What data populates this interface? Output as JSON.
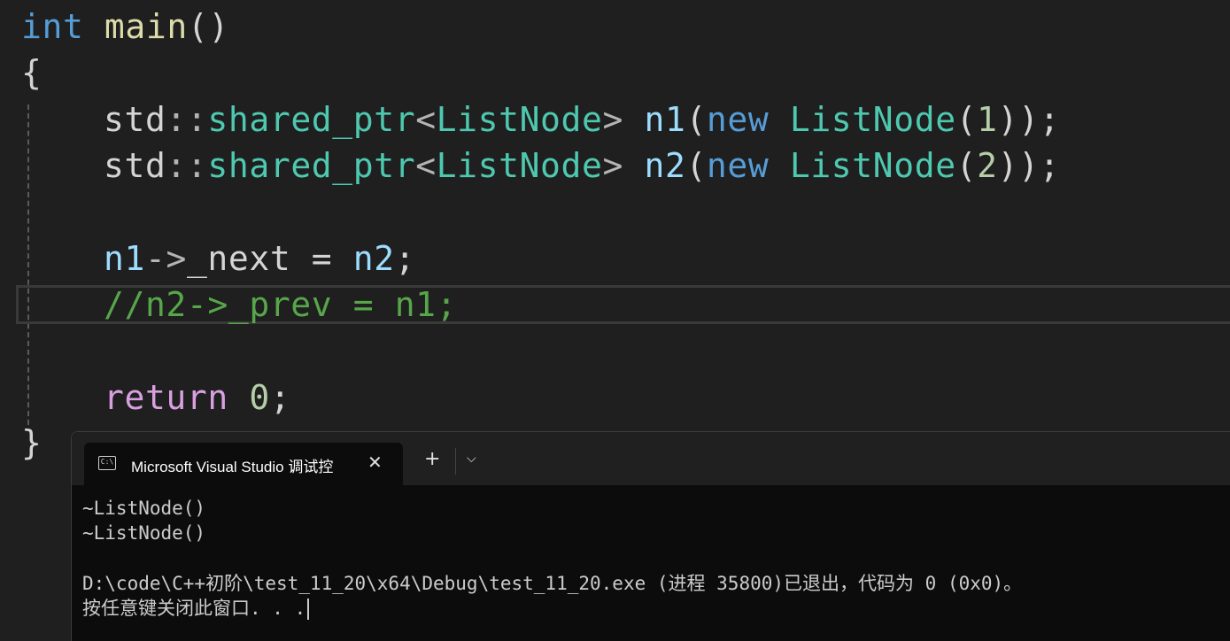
{
  "code": {
    "l1": {
      "kw": "int",
      "fn": "main",
      "rest": "()"
    },
    "l2": "{",
    "l3": {
      "ns": "std",
      "sep": "::",
      "ty": "shared_ptr",
      "lt": "<",
      "ty2": "ListNode",
      "gt": ">",
      "var": "n1",
      "p1": "(",
      "kw": "new",
      "ty3": "ListNode",
      "p2": "(",
      "num": "1",
      "p3": "));"
    },
    "l4": {
      "ns": "std",
      "sep": "::",
      "ty": "shared_ptr",
      "lt": "<",
      "ty2": "ListNode",
      "gt": ">",
      "var": "n2",
      "p1": "(",
      "kw": "new",
      "ty3": "ListNode",
      "p2": "(",
      "num": "2",
      "p3": "));"
    },
    "l5": {
      "var": "n1",
      "op": "->",
      "member": "_next",
      "eq": " = ",
      "var2": "n2",
      "end": ";"
    },
    "l6": "//n2->_prev = n1;",
    "l7": {
      "kw": "return",
      "num": "0",
      "end": ";"
    },
    "l8": "}"
  },
  "terminal": {
    "tab_title": "Microsoft Visual Studio 调试控",
    "tab_icon_text": "C:\\",
    "close": "✕",
    "new_tab": "+",
    "dropdown": "⌵",
    "lines": [
      "~ListNode()",
      "~ListNode()",
      "",
      "D:\\code\\C++初阶\\test_11_20\\x64\\Debug\\test_11_20.exe (进程 35800)已退出，代码为 0 (0x0)。",
      "按任意键关闭此窗口. . ."
    ]
  },
  "colors": {
    "keyword": "#569cd6",
    "function": "#dcdcaa",
    "type": "#4ec9b0",
    "variable": "#9cdcfe",
    "number": "#b5cea8",
    "comment": "#57a64a",
    "control": "#d8a0df"
  }
}
